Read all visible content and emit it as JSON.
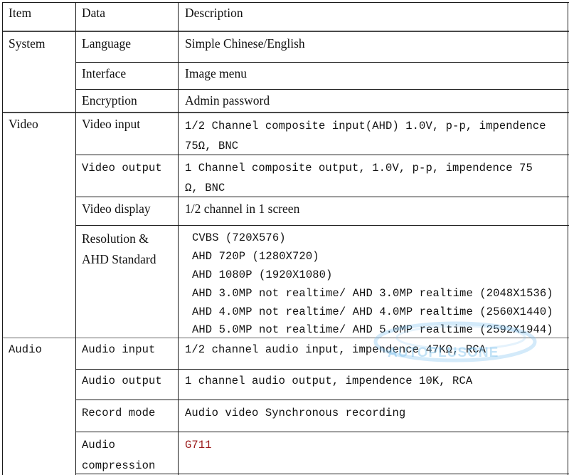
{
  "table": {
    "header": {
      "item": "Item",
      "data": "Data",
      "description": "Description"
    },
    "system": {
      "item": "System",
      "language": {
        "data": "Language",
        "desc": "Simple Chinese/English"
      },
      "interface": {
        "data": "Interface",
        "desc": "Image menu"
      },
      "encryption": {
        "data": "Encryption",
        "desc": "Admin password"
      }
    },
    "video": {
      "item": "Video",
      "input": {
        "data": "Video input",
        "desc_1": "1/2 Channel composite input(AHD) 1.0V,  p-p, impendence",
        "desc_2": "75Ω, BNC"
      },
      "output": {
        "data": "Video output",
        "desc_1": "1 Channel composite output, 1.0V,  p-p, impendence 75",
        "desc_2": "Ω, BNC"
      },
      "display": {
        "data": "Video display",
        "desc": "1/2 channel in 1 screen"
      },
      "resolution": {
        "data_1": "Resolution &",
        "data_2": "AHD Standard",
        "lines": [
          "CVBS  (720X576)",
          "AHD 720P  (1280X720)",
          "AHD 1080P  (1920X1080)",
          "AHD 3.0MP not realtime/ AHD 3.0MP realtime (2048X1536)",
          "AHD 4.0MP not realtime/ AHD 4.0MP realtime  (2560X1440)",
          "AHD 5.0MP not realtime/ AHD 5.0MP realtime  (2592X1944)"
        ]
      }
    },
    "audio": {
      "item": "Audio",
      "input": {
        "data": "Audio input",
        "desc": "1/2 channel audio input, impendence 47KΩ, RCA"
      },
      "output": {
        "data": "Audio output",
        "desc": "1 channel audio output, impendence 10K, RCA"
      },
      "record": {
        "data": "Record mode",
        "desc": "Audio video Synchronous recording"
      },
      "compression": {
        "data_1": "Audio",
        "data_2": "compression",
        "desc": "G711"
      }
    }
  },
  "watermark": {
    "text": "AUTOPLUSONE"
  }
}
